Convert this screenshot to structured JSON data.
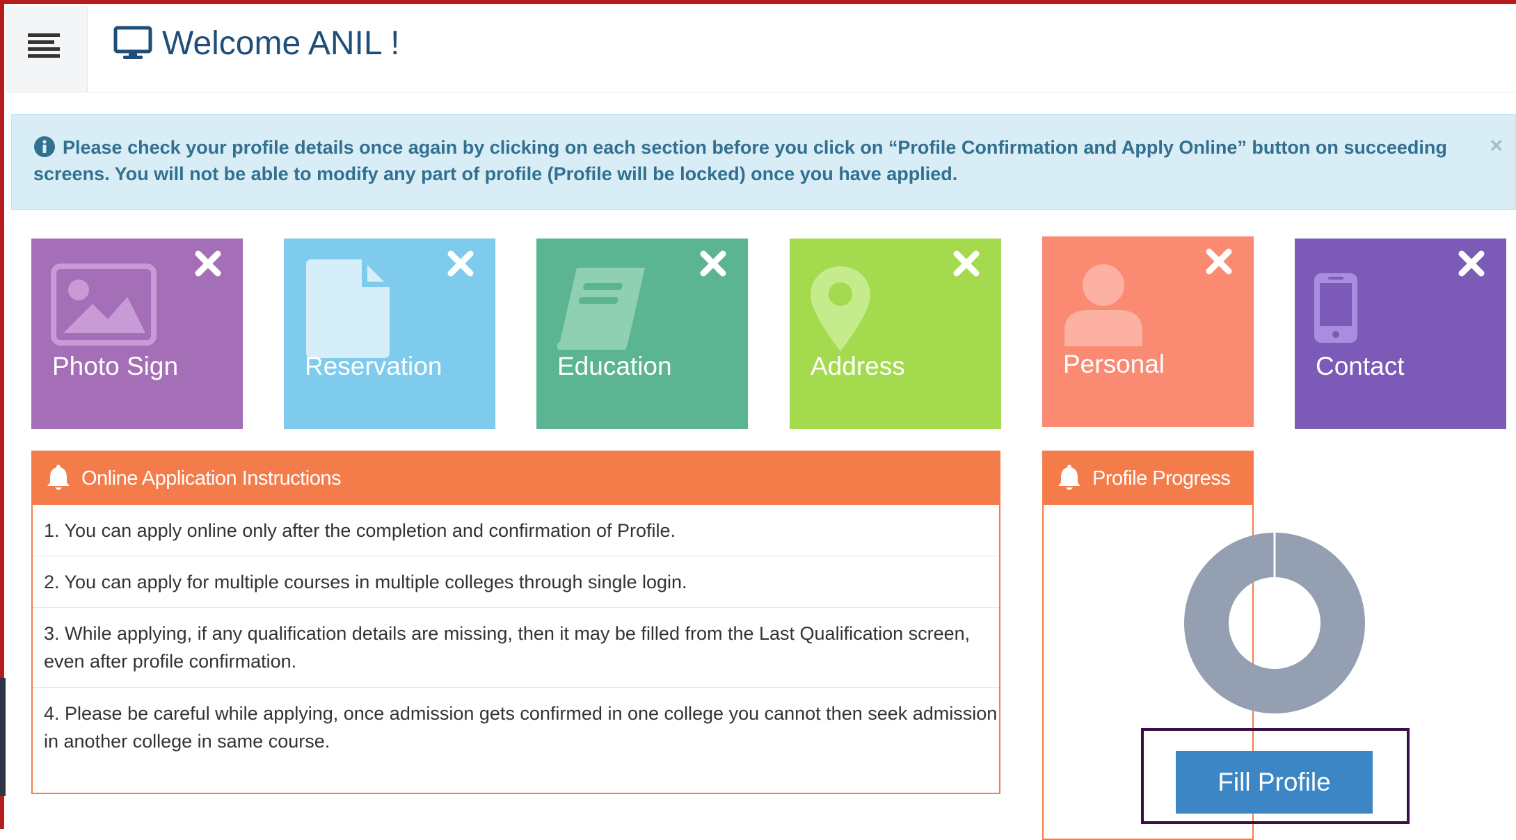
{
  "header": {
    "title": "Welcome ANIL !",
    "menu_icon": "hamburger-icon",
    "title_icon": "desktop-icon"
  },
  "alert": {
    "icon": "info-icon",
    "text": "Please check your profile details once again by clicking on each section before you click on “Profile Confirmation and Apply Online” button on succeeding screens. You will not be able to modify any part of profile (Profile will be locked) once you have applied.",
    "close_label": "×"
  },
  "tiles": [
    {
      "label": "Photo Sign",
      "icon": "image-icon",
      "color": "#a56fb8"
    },
    {
      "label": "Reservation",
      "icon": "document-icon",
      "color": "#7ecbee"
    },
    {
      "label": "Education",
      "icon": "book-icon",
      "color": "#5cb592"
    },
    {
      "label": "Address",
      "icon": "map-marker-icon",
      "color": "#a3da4e"
    },
    {
      "label": "Personal",
      "icon": "user-icon",
      "color": "#fa8a72"
    },
    {
      "label": "Contact",
      "icon": "mobile-phone-icon",
      "color": "#7c5bb8"
    }
  ],
  "instructions": {
    "title": "Online Application Instructions",
    "items": [
      "1. You can apply online only after the completion and confirmation of Profile.",
      "2. You can apply for multiple courses in multiple colleges through single login.",
      "3. While applying, if any qualification details are missing, then it may be filled from the Last Qualification screen, even after profile confirmation.",
      "4. Please be careful while applying, once admission gets confirmed in one college you cannot then seek admission in another college in same course."
    ]
  },
  "progress": {
    "title": "Profile Progress",
    "donut_color": "#949fb1",
    "button_label": "Fill Profile"
  },
  "colors": {
    "panel_header": "#f47c4a",
    "alert_bg": "#d9edf7",
    "alert_text": "#31708f",
    "title_text": "#1f4e79",
    "button": "#3d86c6"
  }
}
